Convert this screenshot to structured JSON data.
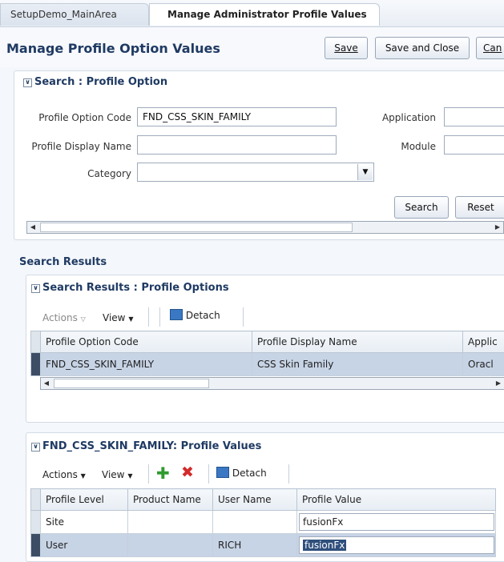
{
  "tabs": [
    {
      "label": "SetupDemo_MainArea"
    },
    {
      "label": "Manage Administrator Profile Values"
    }
  ],
  "page": {
    "title": "Manage Profile Option Values",
    "buttons": {
      "save": "Save",
      "save_close": "Save and Close",
      "cancel": "Can"
    }
  },
  "search": {
    "title": "Search : Profile Option",
    "labels": {
      "code": "Profile Option Code",
      "display_name": "Profile Display Name",
      "category": "Category",
      "application": "Application",
      "module": "Module"
    },
    "values": {
      "code": "FND_CSS_SKIN_FAMILY",
      "display_name": "",
      "category": ""
    },
    "buttons": {
      "search": "Search",
      "reset": "Reset"
    }
  },
  "results": {
    "section_title": "Search Results",
    "panel_title": "Search Results : Profile Options",
    "toolbar": {
      "actions": "Actions",
      "view": "View",
      "detach": "Detach"
    },
    "columns": [
      "Profile Option Code",
      "Profile Display Name",
      "Applic"
    ],
    "rows": [
      [
        "FND_CSS_SKIN_FAMILY",
        "CSS Skin Family",
        "Oracl"
      ]
    ]
  },
  "values_panel": {
    "title": "FND_CSS_SKIN_FAMILY: Profile Values",
    "toolbar": {
      "actions": "Actions",
      "view": "View",
      "detach": "Detach"
    },
    "columns": [
      "Profile Level",
      "Product Name",
      "User Name",
      "Profile Value"
    ],
    "rows": [
      [
        "Site",
        "",
        "",
        "fusionFx"
      ],
      [
        "User",
        "",
        "RICH",
        "fusionFx"
      ]
    ]
  },
  "colors": {
    "accent": "#1f3a63",
    "selected_row": "#c7d4e6",
    "add_icon": "#2e9a2e",
    "delete_icon": "#d42a2a"
  }
}
